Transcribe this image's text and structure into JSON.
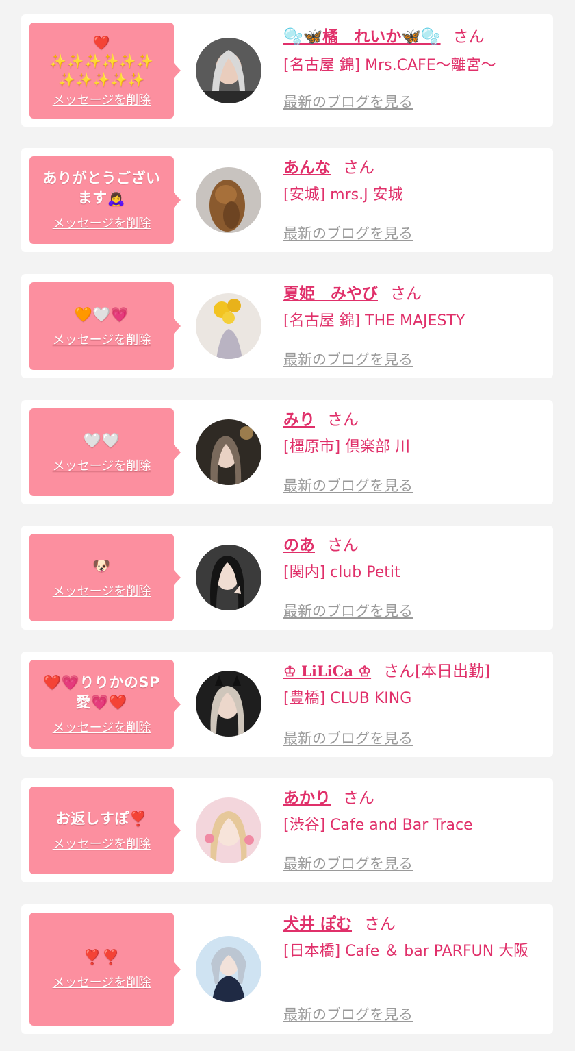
{
  "messages": [
    {
      "bubble_text": "❤️\n✨✨✨✨✨✨\n✨✨✨✨✨",
      "delete_label": "メッセージを削除",
      "name": "🫧🦋橘　れいか🦋🫧",
      "honorific": "さん",
      "tag": "",
      "shop": "[名古屋 錦] Mrs.CAFE～離宮～",
      "blog_label": "最新のブログを見る"
    },
    {
      "bubble_text": "ありがとうございます🙇‍♀️",
      "delete_label": "メッセージを削除",
      "name": "あんな",
      "honorific": "さん",
      "tag": "",
      "shop": "[安城] mrs.J 安城",
      "blog_label": "最新のブログを見る"
    },
    {
      "bubble_text": "🧡🤍💗",
      "delete_label": "メッセージを削除",
      "name": "夏姫　みやび",
      "honorific": "さん",
      "tag": "",
      "shop": "[名古屋 錦] THE MAJESTY",
      "blog_label": "最新のブログを見る"
    },
    {
      "bubble_text": "🤍🤍",
      "delete_label": "メッセージを削除",
      "name": "みり",
      "honorific": "さん",
      "tag": "",
      "shop": "[橿原市] 倶楽部 川",
      "blog_label": "最新のブログを見る"
    },
    {
      "bubble_text": "🐶",
      "delete_label": "メッセージを削除",
      "name": "のあ",
      "honorific": "さん",
      "tag": "",
      "shop": "[関内] club Petit",
      "blog_label": "最新のブログを見る"
    },
    {
      "bubble_text": "❤️💗りりかのSP愛💗❤️",
      "delete_label": "メッセージを削除",
      "name": "♔ LiLiCa ♔",
      "honorific": "さん",
      "tag": "[本日出勤]",
      "shop": "[豊橋] CLUB KING",
      "blog_label": "最新のブログを見る"
    },
    {
      "bubble_text": "お返しすぽ❣️",
      "delete_label": "メッセージを削除",
      "name": "あかり",
      "honorific": "さん",
      "tag": "",
      "shop": "[渋谷] Cafe and Bar Trace",
      "blog_label": "最新のブログを見る"
    },
    {
      "bubble_text": "❣️❣️",
      "delete_label": "メッセージを削除",
      "name": "犬井 ぽむ",
      "honorific": "さん",
      "tag": "",
      "shop": "[日本橋] Cafe ＆ bar PARFUN 大阪",
      "blog_label": "最新のブログを見る"
    }
  ],
  "colors": {
    "bubble": "#fc8f9f",
    "accent_text": "#e0306a",
    "link_gray": "#9a9a9a",
    "page_bg": "#f3f3f3"
  }
}
